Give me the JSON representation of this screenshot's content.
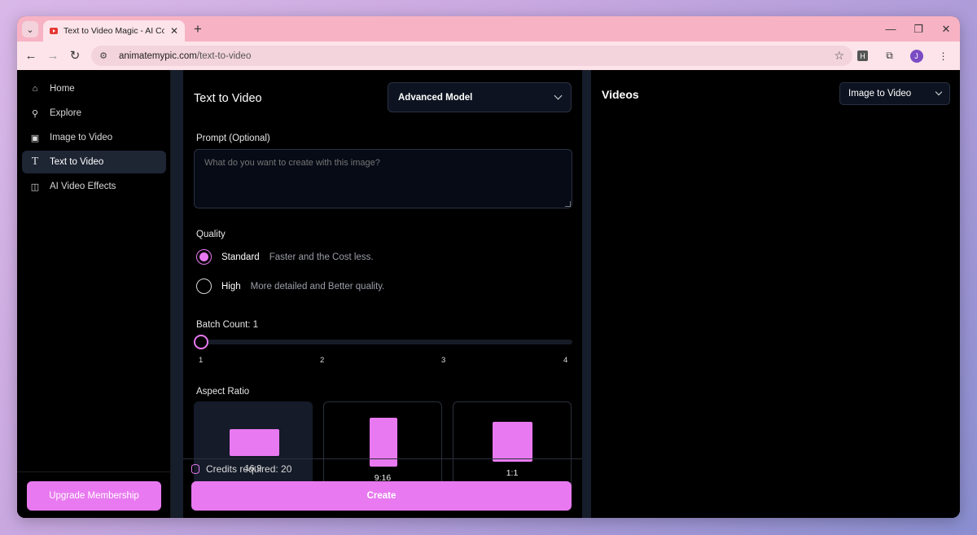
{
  "browser": {
    "tab_title": "Text to Video Magic - AI Conten",
    "url_domain": "animatemypic.com",
    "url_path": "/text-to-video",
    "avatar_letter": "J",
    "ext_letter": "H"
  },
  "sidebar": {
    "items": [
      {
        "label": "Home",
        "icon": "home-icon"
      },
      {
        "label": "Explore",
        "icon": "search-icon"
      },
      {
        "label": "Image to Video",
        "icon": "image-icon"
      },
      {
        "label": "Text to Video",
        "icon": "text-icon",
        "active": true
      },
      {
        "label": "AI Video Effects",
        "icon": "layout-icon"
      }
    ],
    "upgrade_label": "Upgrade Membership"
  },
  "form": {
    "title": "Text to Video",
    "model_select": "Advanced Model",
    "prompt_label": "Prompt (Optional)",
    "prompt_placeholder": "What do you want to create with this image?",
    "quality_label": "Quality",
    "quality_options": [
      {
        "label": "Standard",
        "desc": "Faster and the Cost less.",
        "checked": true
      },
      {
        "label": "High",
        "desc": "More detailed and Better quality.",
        "checked": false
      }
    ],
    "batch_label": "Batch Count: 1",
    "batch_ticks": [
      "1",
      "2",
      "3",
      "4"
    ],
    "batch_value": 1,
    "aspect_label": "Aspect Ratio",
    "aspect_options": [
      {
        "label": "16:9",
        "selected": true
      },
      {
        "label": "9:16",
        "selected": false
      },
      {
        "label": "1:1",
        "selected": false
      }
    ],
    "credits_text": "Credits required: 20",
    "create_label": "Create"
  },
  "videos": {
    "title": "Videos",
    "select_value": "Image to Video"
  },
  "colors": {
    "accent": "#e879f0",
    "panel": "#0d1320",
    "strip": "#161d2b"
  }
}
